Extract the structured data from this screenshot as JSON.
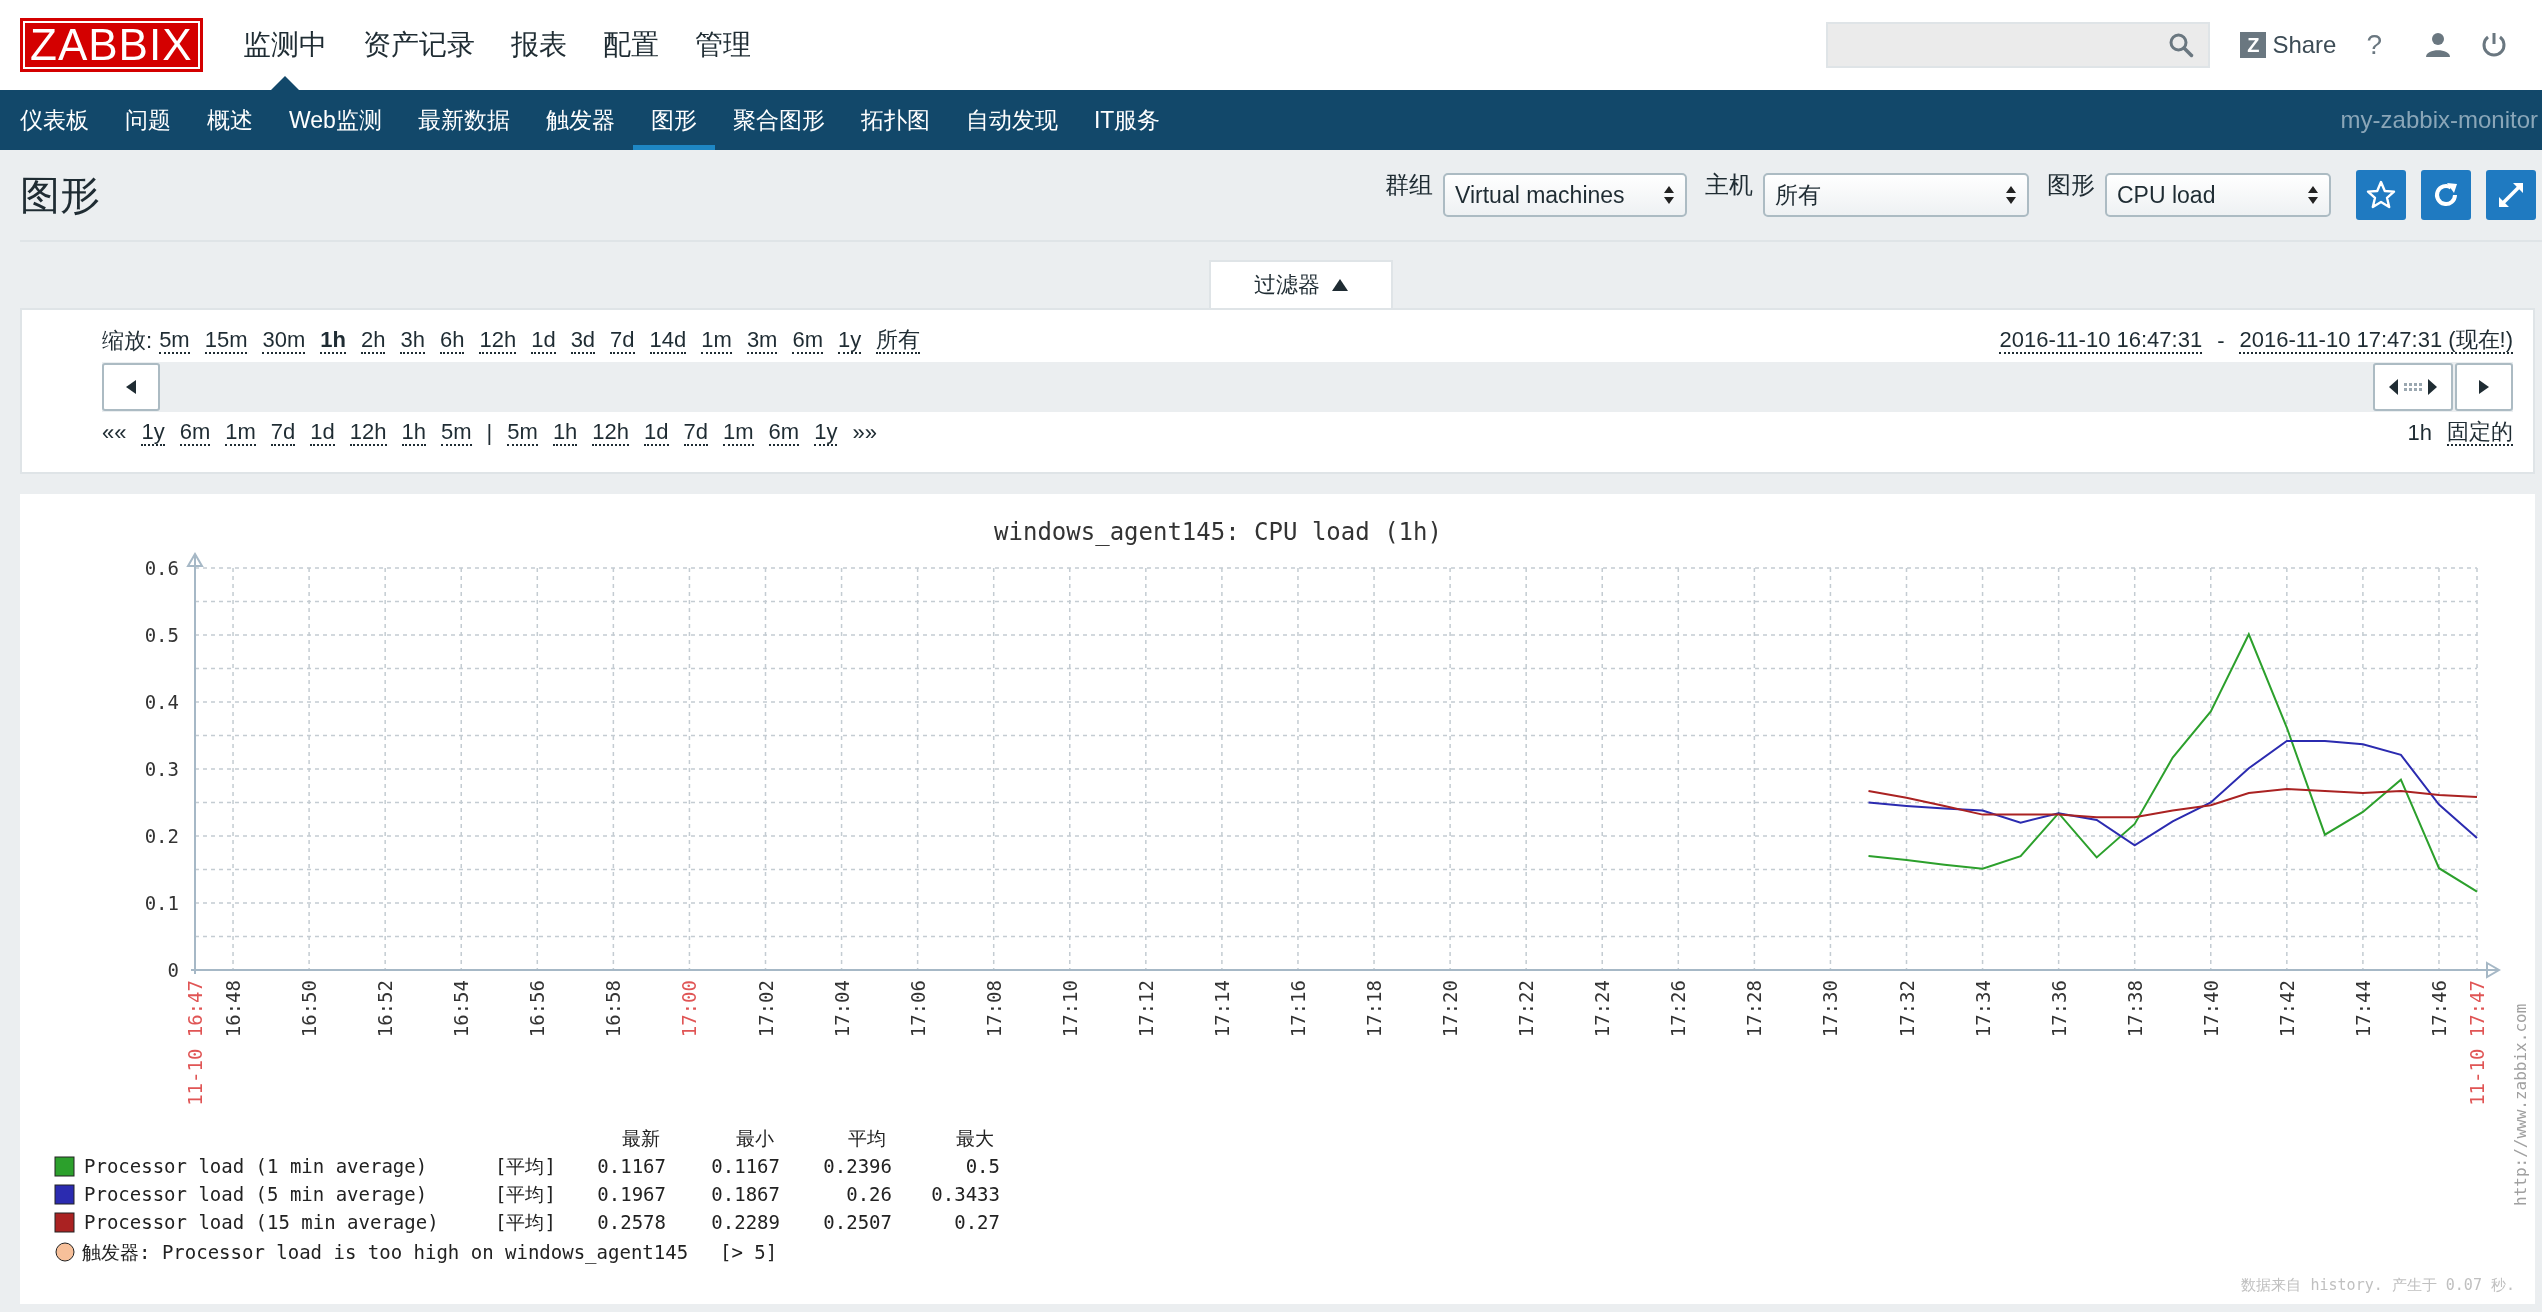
{
  "header": {
    "logo": "ZABBIX",
    "menu": [
      {
        "label": "监测中",
        "selected": true
      },
      {
        "label": "资产记录",
        "selected": false
      },
      {
        "label": "报表",
        "selected": false
      },
      {
        "label": "配置",
        "selected": false
      },
      {
        "label": "管理",
        "selected": false
      }
    ],
    "share_badge": "Z",
    "share": "Share",
    "help": "?"
  },
  "subnav": {
    "items": [
      {
        "label": "仪表板",
        "selected": false
      },
      {
        "label": "问题",
        "selected": false
      },
      {
        "label": "概述",
        "selected": false
      },
      {
        "label": "Web监测",
        "selected": false
      },
      {
        "label": "最新数据",
        "selected": false
      },
      {
        "label": "触发器",
        "selected": false
      },
      {
        "label": "图形",
        "selected": true
      },
      {
        "label": "聚合图形",
        "selected": false
      },
      {
        "label": "拓扑图",
        "selected": false
      },
      {
        "label": "自动发现",
        "selected": false
      },
      {
        "label": "IT服务",
        "selected": false
      }
    ],
    "server": "my-zabbix-monitor"
  },
  "page": {
    "title": "图形",
    "filters": [
      {
        "label": "群组",
        "value": "Virtual machines"
      },
      {
        "label": "主机",
        "value": "所有"
      },
      {
        "label": "图形",
        "value": "CPU load"
      }
    ]
  },
  "filter_tab": {
    "label": "过滤器",
    "expanded": true
  },
  "timeline": {
    "zoom_label": "缩放:",
    "zoom": [
      {
        "label": "5m",
        "selected": false
      },
      {
        "label": "15m",
        "selected": false
      },
      {
        "label": "30m",
        "selected": false
      },
      {
        "label": "1h",
        "selected": true
      },
      {
        "label": "2h",
        "selected": false
      },
      {
        "label": "3h",
        "selected": false
      },
      {
        "label": "6h",
        "selected": false
      },
      {
        "label": "12h",
        "selected": false
      },
      {
        "label": "1d",
        "selected": false
      },
      {
        "label": "3d",
        "selected": false
      },
      {
        "label": "7d",
        "selected": false
      },
      {
        "label": "14d",
        "selected": false
      },
      {
        "label": "1m",
        "selected": false
      },
      {
        "label": "3m",
        "selected": false
      },
      {
        "label": "6m",
        "selected": false
      },
      {
        "label": "1y",
        "selected": false
      },
      {
        "label": "所有",
        "selected": false
      }
    ],
    "range_from": "2016-11-10 16:47:31",
    "range_sep": "-",
    "range_to": "2016-11-10 17:47:31 (现在!)",
    "nav": [
      {
        "kind": "text",
        "label": "««"
      },
      {
        "kind": "link",
        "label": "1y"
      },
      {
        "kind": "link",
        "label": "6m"
      },
      {
        "kind": "link",
        "label": "1m"
      },
      {
        "kind": "link",
        "label": "7d"
      },
      {
        "kind": "link",
        "label": "1d"
      },
      {
        "kind": "link",
        "label": "12h"
      },
      {
        "kind": "link",
        "label": "1h"
      },
      {
        "kind": "link",
        "label": "5m"
      },
      {
        "kind": "text",
        "label": "|"
      },
      {
        "kind": "link",
        "label": "5m"
      },
      {
        "kind": "link",
        "label": "1h"
      },
      {
        "kind": "link",
        "label": "12h"
      },
      {
        "kind": "link",
        "label": "1d"
      },
      {
        "kind": "link",
        "label": "7d"
      },
      {
        "kind": "link",
        "label": "1m"
      },
      {
        "kind": "link",
        "label": "6m"
      },
      {
        "kind": "link",
        "label": "1y"
      },
      {
        "kind": "text",
        "label": "»»"
      }
    ],
    "period": "1h",
    "fixed": "固定的"
  },
  "chart": {
    "chart_data": {
      "type": "line",
      "title": "windows_agent145: CPU load (1h)",
      "categories": [
        "11-10 16:47",
        "16:48",
        null,
        "16:50",
        null,
        "16:52",
        null,
        "16:54",
        null,
        "16:56",
        null,
        "16:58",
        null,
        "17:00",
        null,
        "17:02",
        null,
        "17:04",
        null,
        "17:06",
        null,
        "17:08",
        null,
        "17:10",
        null,
        "17:12",
        null,
        "17:14",
        null,
        "17:16",
        null,
        "17:18",
        null,
        "17:20",
        null,
        "17:22",
        null,
        "17:24",
        null,
        "17:26",
        null,
        "17:28",
        null,
        "17:30",
        null,
        "17:32",
        null,
        "17:34",
        null,
        "17:36",
        null,
        "17:38",
        null,
        "17:40",
        null,
        "17:42",
        null,
        "17:44",
        null,
        "17:46",
        "11-10 17:47"
      ],
      "grid": true,
      "legend": true,
      "ylim": [
        0,
        0.6
      ],
      "yticks": [
        0,
        0.1,
        0.2,
        0.3,
        0.4,
        0.5,
        0.6
      ],
      "series": [
        {
          "name": "Processor load (1 min average)",
          "color": "#2ca02c",
          "values": [
            null,
            null,
            null,
            null,
            null,
            null,
            null,
            null,
            null,
            null,
            null,
            null,
            null,
            null,
            null,
            null,
            null,
            null,
            null,
            null,
            null,
            null,
            null,
            null,
            null,
            null,
            null,
            null,
            null,
            null,
            null,
            null,
            null,
            null,
            null,
            null,
            null,
            null,
            null,
            null,
            null,
            null,
            null,
            null,
            0.17,
            0.164,
            0.157,
            0.151,
            0.17,
            0.234,
            0.168,
            0.218,
            0.317,
            0.386,
            0.501,
            0.362,
            0.202,
            0.236,
            0.284,
            0.152,
            0.117
          ]
        },
        {
          "name": "Processor load (5 min average)",
          "color": "#2b2bb0",
          "values": [
            null,
            null,
            null,
            null,
            null,
            null,
            null,
            null,
            null,
            null,
            null,
            null,
            null,
            null,
            null,
            null,
            null,
            null,
            null,
            null,
            null,
            null,
            null,
            null,
            null,
            null,
            null,
            null,
            null,
            null,
            null,
            null,
            null,
            null,
            null,
            null,
            null,
            null,
            null,
            null,
            null,
            null,
            null,
            null,
            0.25,
            0.245,
            0.241,
            0.238,
            0.22,
            0.234,
            0.224,
            0.186,
            0.222,
            0.25,
            0.301,
            0.342,
            0.342,
            0.337,
            0.321,
            0.247,
            0.197
          ]
        },
        {
          "name": "Processor load (15 min average)",
          "color": "#aa2222",
          "values": [
            null,
            null,
            null,
            null,
            null,
            null,
            null,
            null,
            null,
            null,
            null,
            null,
            null,
            null,
            null,
            null,
            null,
            null,
            null,
            null,
            null,
            null,
            null,
            null,
            null,
            null,
            null,
            null,
            null,
            null,
            null,
            null,
            null,
            null,
            null,
            null,
            null,
            null,
            null,
            null,
            null,
            null,
            null,
            null,
            0.267,
            0.257,
            0.245,
            0.232,
            0.232,
            0.232,
            0.228,
            0.228,
            0.238,
            0.246,
            0.264,
            0.27,
            0.267,
            0.264,
            0.267,
            0.261,
            0.258
          ]
        }
      ]
    },
    "legend_columns": [
      "最新",
      "最小",
      "平均",
      "最大"
    ],
    "legend": [
      {
        "func": "[平均]",
        "values": [
          "0.1167",
          "0.1167",
          "0.2396",
          "0.5"
        ]
      },
      {
        "func": "[平均]",
        "values": [
          "0.1967",
          "0.1867",
          "0.26",
          "0.3433"
        ]
      },
      {
        "func": "[平均]",
        "values": [
          "0.2578",
          "0.2289",
          "0.2507",
          "0.27"
        ]
      }
    ],
    "trigger": {
      "text": "触发器: Processor load is too high on windows_agent145",
      "condition": "[> 5]",
      "color": "#f7c09a"
    },
    "watermark": "http://www.zabbix.com",
    "footer": "数据来自 history. 产生于 0.07 秒."
  }
}
